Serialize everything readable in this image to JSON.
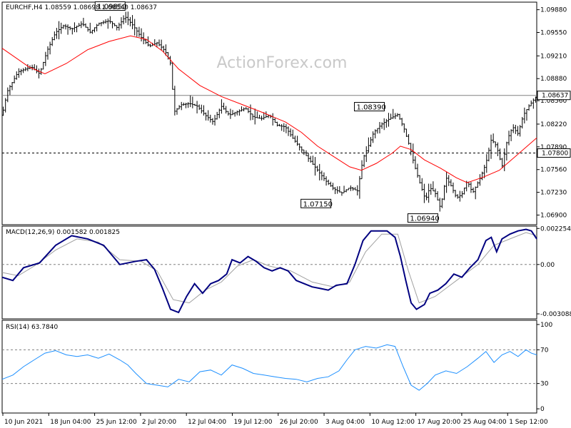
{
  "watermark": "ActionForex.com",
  "colors": {
    "background": "#ffffff",
    "frame": "#000000",
    "bars": "#000000",
    "sma": "#ff0000",
    "macd_line": "#000080",
    "macd_signal": "#a0a0a0",
    "rsi": "#1e90ff",
    "ref_line": "#808080",
    "level_line": "#000000"
  },
  "chart_data": [
    {
      "type": "ohlc",
      "title": "EURCHF,H4 1.08559 1.08698 1.08540 1.08637",
      "symbol": "EURCHF",
      "timeframe": "H4",
      "ohlc_last": {
        "open": 1.08559,
        "high": 1.08698,
        "low": 1.0854,
        "close": 1.08637
      },
      "ylim": [
        1.0676,
        1.0999
      ],
      "y_ticks": [
        "1.09880",
        "1.09550",
        "1.09210",
        "1.08880",
        "1.08560",
        "1.08220",
        "1.07890",
        "1.07560",
        "1.07230",
        "1.06900"
      ],
      "current_price_label": "1.08637",
      "current_price": 1.08637,
      "level_label": "1.07800",
      "level": 1.078,
      "annotations": [
        {
          "label": "1.09850",
          "value": 1.0985,
          "x": 0.23
        },
        {
          "label": "1.08390",
          "value": 1.0839,
          "x": 0.715
        },
        {
          "label": "1.07150",
          "value": 1.0715,
          "x": 0.615
        },
        {
          "label": "1.06940",
          "value": 1.0694,
          "x": 0.815
        }
      ],
      "price_path": [
        [
          0.0,
          1.0835
        ],
        [
          0.01,
          1.087
        ],
        [
          0.03,
          1.0898
        ],
        [
          0.055,
          1.0905
        ],
        [
          0.07,
          1.0895
        ],
        [
          0.085,
          1.093
        ],
        [
          0.1,
          1.0955
        ],
        [
          0.115,
          1.0965
        ],
        [
          0.13,
          1.096
        ],
        [
          0.15,
          1.0968
        ],
        [
          0.165,
          1.0955
        ],
        [
          0.18,
          1.0968
        ],
        [
          0.2,
          1.0972
        ],
        [
          0.215,
          1.0962
        ],
        [
          0.23,
          1.0978
        ],
        [
          0.245,
          1.0965
        ],
        [
          0.26,
          1.0948
        ],
        [
          0.275,
          1.0935
        ],
        [
          0.29,
          1.094
        ],
        [
          0.305,
          1.0928
        ],
        [
          0.315,
          1.091
        ],
        [
          0.322,
          1.084
        ],
        [
          0.335,
          1.085
        ],
        [
          0.35,
          1.0852
        ],
        [
          0.365,
          1.0848
        ],
        [
          0.38,
          1.0835
        ],
        [
          0.395,
          1.0825
        ],
        [
          0.41,
          1.0848
        ],
        [
          0.425,
          1.0835
        ],
        [
          0.44,
          1.084
        ],
        [
          0.455,
          1.0845
        ],
        [
          0.47,
          1.0832
        ],
        [
          0.485,
          1.083
        ],
        [
          0.5,
          1.0835
        ],
        [
          0.515,
          1.082
        ],
        [
          0.53,
          1.0818
        ],
        [
          0.545,
          1.08
        ],
        [
          0.56,
          1.0785
        ],
        [
          0.575,
          1.077
        ],
        [
          0.59,
          1.0755
        ],
        [
          0.605,
          1.074
        ],
        [
          0.62,
          1.0728
        ],
        [
          0.635,
          1.0722
        ],
        [
          0.65,
          1.073
        ],
        [
          0.665,
          1.0725
        ],
        [
          0.675,
          1.0772
        ],
        [
          0.685,
          1.079
        ],
        [
          0.695,
          1.081
        ],
        [
          0.71,
          1.0822
        ],
        [
          0.725,
          1.083
        ],
        [
          0.74,
          1.0836
        ],
        [
          0.752,
          1.0815
        ],
        [
          0.762,
          1.079
        ],
        [
          0.772,
          1.076
        ],
        [
          0.782,
          1.0735
        ],
        [
          0.792,
          1.0712
        ],
        [
          0.8,
          1.073
        ],
        [
          0.81,
          1.0722
        ],
        [
          0.82,
          1.07
        ],
        [
          0.83,
          1.0745
        ],
        [
          0.84,
          1.0732
        ],
        [
          0.85,
          1.0715
        ],
        [
          0.86,
          1.072
        ],
        [
          0.87,
          1.074
        ],
        [
          0.88,
          1.0722
        ],
        [
          0.895,
          1.0745
        ],
        [
          0.905,
          1.0765
        ],
        [
          0.915,
          1.08
        ],
        [
          0.925,
          1.079
        ],
        [
          0.935,
          1.076
        ],
        [
          0.945,
          1.08
        ],
        [
          0.955,
          1.0818
        ],
        [
          0.965,
          1.0808
        ],
        [
          0.975,
          1.0835
        ],
        [
          0.985,
          1.0848
        ],
        [
          0.995,
          1.0858
        ],
        [
          1.0,
          1.0863
        ]
      ],
      "moving_average": [
        [
          0.0,
          1.0932
        ],
        [
          0.05,
          1.0905
        ],
        [
          0.08,
          1.0895
        ],
        [
          0.12,
          1.091
        ],
        [
          0.16,
          1.093
        ],
        [
          0.2,
          1.0942
        ],
        [
          0.24,
          1.095
        ],
        [
          0.27,
          1.0945
        ],
        [
          0.3,
          1.0928
        ],
        [
          0.33,
          1.0902
        ],
        [
          0.37,
          1.0878
        ],
        [
          0.41,
          1.0862
        ],
        [
          0.45,
          1.085
        ],
        [
          0.49,
          1.0838
        ],
        [
          0.53,
          1.0825
        ],
        [
          0.56,
          1.081
        ],
        [
          0.59,
          1.079
        ],
        [
          0.62,
          1.0775
        ],
        [
          0.65,
          1.076
        ],
        [
          0.672,
          1.0755
        ],
        [
          0.7,
          1.0765
        ],
        [
          0.73,
          1.078
        ],
        [
          0.745,
          1.079
        ],
        [
          0.765,
          1.0785
        ],
        [
          0.79,
          1.077
        ],
        [
          0.82,
          1.0758
        ],
        [
          0.85,
          1.0744
        ],
        [
          0.87,
          1.0737
        ],
        [
          0.9,
          1.0745
        ],
        [
          0.93,
          1.0755
        ],
        [
          0.96,
          1.0775
        ],
        [
          1.0,
          1.0802
        ]
      ],
      "x_ticks": [
        "10 Jun 2021",
        "18 Jun 04:00",
        "25 Jun 12:00",
        "2 Jul 20:00",
        "12 Jul 04:00",
        "19 Jul 12:00",
        "26 Jul 20:00",
        "3 Aug 04:00",
        "10 Aug 12:00",
        "17 Aug 20:00",
        "25 Aug 04:00",
        "1 Sep 12:00"
      ]
    },
    {
      "type": "line",
      "title": "MACD(12,26,9) 0.001582 0.001825",
      "params": "12,26,9",
      "ylim": [
        -0.0034,
        0.0024
      ],
      "y_ticks": [
        "0.002254",
        "0.00",
        "-0.003088"
      ],
      "series": [
        {
          "values": [
            [
              0.0,
              -0.0008
            ],
            [
              0.02,
              -0.001
            ],
            [
              0.04,
              -0.0002
            ],
            [
              0.07,
              0.0001
            ],
            [
              0.1,
              0.0012
            ],
            [
              0.13,
              0.0018
            ],
            [
              0.16,
              0.0016
            ],
            [
              0.19,
              0.0012
            ],
            [
              0.22,
              0.0
            ],
            [
              0.25,
              0.0002
            ],
            [
              0.27,
              0.0003
            ],
            [
              0.285,
              -0.0003
            ],
            [
              0.3,
              -0.0015
            ],
            [
              0.315,
              -0.0028
            ],
            [
              0.33,
              -0.003
            ],
            [
              0.345,
              -0.002
            ],
            [
              0.36,
              -0.0012
            ],
            [
              0.375,
              -0.0018
            ],
            [
              0.39,
              -0.0012
            ],
            [
              0.405,
              -0.001
            ],
            [
              0.42,
              -0.0006
            ],
            [
              0.43,
              0.0003
            ],
            [
              0.445,
              0.0001
            ],
            [
              0.46,
              0.0005
            ],
            [
              0.475,
              0.0002
            ],
            [
              0.49,
              -0.0002
            ],
            [
              0.505,
              -0.0004
            ],
            [
              0.52,
              -0.0002
            ],
            [
              0.535,
              -0.0004
            ],
            [
              0.55,
              -0.001
            ],
            [
              0.565,
              -0.0012
            ],
            [
              0.58,
              -0.0014
            ],
            [
              0.595,
              -0.0015
            ],
            [
              0.61,
              -0.0016
            ],
            [
              0.625,
              -0.0013
            ],
            [
              0.645,
              -0.0012
            ],
            [
              0.66,
              0.0
            ],
            [
              0.675,
              0.0015
            ],
            [
              0.69,
              0.0021
            ],
            [
              0.705,
              0.0021
            ],
            [
              0.72,
              0.0021
            ],
            [
              0.735,
              0.0017
            ],
            [
              0.745,
              0.0005
            ],
            [
              0.755,
              -0.001
            ],
            [
              0.765,
              -0.0024
            ],
            [
              0.775,
              -0.0028
            ],
            [
              0.79,
              -0.0025
            ],
            [
              0.8,
              -0.0018
            ],
            [
              0.815,
              -0.0016
            ],
            [
              0.83,
              -0.0012
            ],
            [
              0.845,
              -0.0006
            ],
            [
              0.86,
              -0.0008
            ],
            [
              0.875,
              -0.0002
            ],
            [
              0.89,
              0.0003
            ],
            [
              0.905,
              0.0015
            ],
            [
              0.915,
              0.0017
            ],
            [
              0.925,
              0.0008
            ],
            [
              0.935,
              0.0016
            ],
            [
              0.95,
              0.0019
            ],
            [
              0.965,
              0.0021
            ],
            [
              0.98,
              0.0022
            ],
            [
              0.99,
              0.0021
            ],
            [
              1.0,
              0.0016
            ]
          ]
        },
        {
          "values": [
            [
              0.0,
              -0.0005
            ],
            [
              0.03,
              -0.0007
            ],
            [
              0.06,
              -0.0001
            ],
            [
              0.1,
              0.0009
            ],
            [
              0.14,
              0.0016
            ],
            [
              0.18,
              0.0014
            ],
            [
              0.22,
              0.0003
            ],
            [
              0.26,
              0.0002
            ],
            [
              0.29,
              -0.0004
            ],
            [
              0.32,
              -0.0022
            ],
            [
              0.35,
              -0.0024
            ],
            [
              0.38,
              -0.0016
            ],
            [
              0.41,
              -0.0011
            ],
            [
              0.44,
              -0.0001
            ],
            [
              0.47,
              0.0003
            ],
            [
              0.5,
              -0.0001
            ],
            [
              0.54,
              -0.0004
            ],
            [
              0.58,
              -0.0011
            ],
            [
              0.62,
              -0.0014
            ],
            [
              0.65,
              -0.0011
            ],
            [
              0.68,
              0.0008
            ],
            [
              0.71,
              0.0019
            ],
            [
              0.74,
              0.0019
            ],
            [
              0.76,
              -0.0004
            ],
            [
              0.78,
              -0.0024
            ],
            [
              0.81,
              -0.002
            ],
            [
              0.85,
              -0.001
            ],
            [
              0.89,
              0.0
            ],
            [
              0.92,
              0.0012
            ],
            [
              0.95,
              0.0016
            ],
            [
              0.98,
              0.002
            ],
            [
              1.0,
              0.0018
            ]
          ]
        }
      ]
    },
    {
      "type": "line",
      "title": "RSI(14) 63.7840",
      "params": "14",
      "ylim": [
        -5,
        105
      ],
      "y_ticks": [
        "100",
        "70",
        "30",
        "0"
      ],
      "y_tick_values": [
        100,
        70,
        30,
        0
      ],
      "series": [
        {
          "values": [
            [
              0.0,
              35
            ],
            [
              0.02,
              40
            ],
            [
              0.04,
              50
            ],
            [
              0.06,
              58
            ],
            [
              0.08,
              66
            ],
            [
              0.1,
              69
            ],
            [
              0.12,
              64
            ],
            [
              0.14,
              62
            ],
            [
              0.16,
              64
            ],
            [
              0.18,
              60
            ],
            [
              0.2,
              65
            ],
            [
              0.22,
              58
            ],
            [
              0.235,
              52
            ],
            [
              0.25,
              42
            ],
            [
              0.27,
              30
            ],
            [
              0.29,
              28
            ],
            [
              0.31,
              26
            ],
            [
              0.33,
              35
            ],
            [
              0.35,
              32
            ],
            [
              0.37,
              44
            ],
            [
              0.39,
              46
            ],
            [
              0.41,
              40
            ],
            [
              0.43,
              52
            ],
            [
              0.45,
              48
            ],
            [
              0.47,
              42
            ],
            [
              0.49,
              40
            ],
            [
              0.51,
              38
            ],
            [
              0.53,
              36
            ],
            [
              0.55,
              35
            ],
            [
              0.57,
              32
            ],
            [
              0.59,
              36
            ],
            [
              0.61,
              38
            ],
            [
              0.63,
              45
            ],
            [
              0.645,
              58
            ],
            [
              0.66,
              70
            ],
            [
              0.68,
              74
            ],
            [
              0.7,
              72
            ],
            [
              0.72,
              76
            ],
            [
              0.735,
              74
            ],
            [
              0.75,
              50
            ],
            [
              0.765,
              28
            ],
            [
              0.78,
              22
            ],
            [
              0.795,
              30
            ],
            [
              0.81,
              40
            ],
            [
              0.83,
              45
            ],
            [
              0.85,
              42
            ],
            [
              0.87,
              50
            ],
            [
              0.89,
              60
            ],
            [
              0.905,
              68
            ],
            [
              0.92,
              55
            ],
            [
              0.935,
              64
            ],
            [
              0.95,
              68
            ],
            [
              0.965,
              62
            ],
            [
              0.98,
              70
            ],
            [
              0.99,
              66
            ],
            [
              1.0,
              64
            ]
          ]
        }
      ]
    }
  ]
}
